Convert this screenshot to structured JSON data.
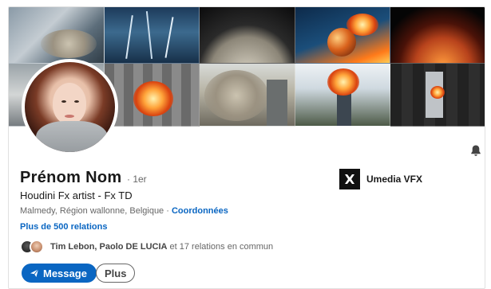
{
  "profile": {
    "name": "Prénom Nom",
    "degree": "· 1er",
    "headline": "Houdini Fx artist - Fx TD",
    "location": "Malmedy, Région wallonne, Belgique",
    "location_separator": " · ",
    "contact_link": "Coordonnées",
    "relations": "Plus de 500 relations",
    "mutual": {
      "names": "Tim Lebon, Paolo DE LUCIA",
      "rest": " et 17 relations en commun"
    }
  },
  "company": {
    "name": "Umedia VFX",
    "logo_icon": "umedia-logo-icon"
  },
  "actions": {
    "message_label": "Message",
    "more_label": "Plus"
  },
  "icons": {
    "notification": "bell-icon",
    "send": "send-icon"
  },
  "colors": {
    "accent": "#0a66c2",
    "text_primary": "#191919",
    "text_secondary": "#666666"
  }
}
